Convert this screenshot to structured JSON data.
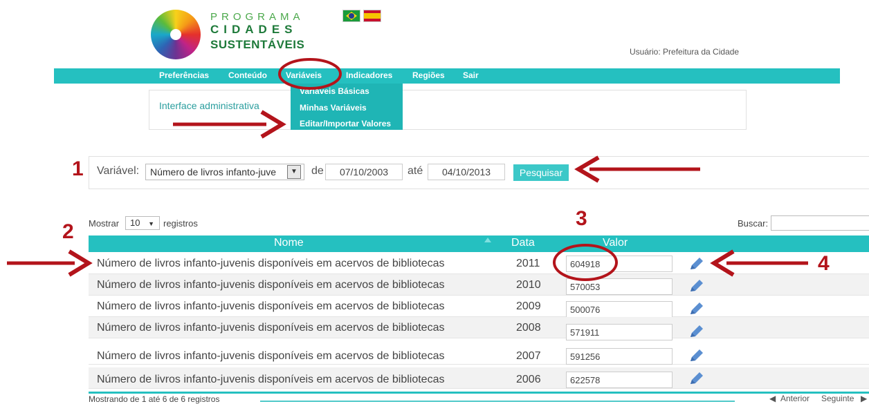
{
  "header": {
    "logo_line1": "PROGRAMA",
    "logo_line2": "CIDADES",
    "logo_line3": "SUSTENTÁVEIS",
    "user_label": "Usuário: Prefeitura da Cidade",
    "flags": [
      "brazil-flag-icon",
      "spain-flag-icon"
    ]
  },
  "nav": {
    "items": [
      "Preferências",
      "Conteúdo",
      "Variáveis",
      "Indicadores",
      "Regiões",
      "Sair"
    ],
    "dropdown": [
      "Variáveis Básicas",
      "Minhas Variáveis",
      "Editar/Importar Valores"
    ]
  },
  "admin": {
    "title": "Interface administrativa"
  },
  "filter": {
    "variable_label": "Variável:",
    "variable_value": "Número de livros infanto-juve",
    "from_label": "de",
    "from_value": "07/10/2003",
    "to_label": "até",
    "to_value": "04/10/2013",
    "search_button": "Pesquisar"
  },
  "table": {
    "show_prefix": "Mostrar",
    "show_value": "10",
    "show_suffix": "registros",
    "search_label": "Buscar:",
    "columns": [
      "Nome",
      "Data",
      "Valor"
    ],
    "rows": [
      {
        "name": "Número de livros infanto-juvenis disponíveis em acervos de bibliotecas",
        "year": "2011",
        "value": "604918"
      },
      {
        "name": "Número de livros infanto-juvenis disponíveis em acervos de bibliotecas",
        "year": "2010",
        "value": "570053"
      },
      {
        "name": "Número de livros infanto-juvenis disponíveis em acervos de bibliotecas",
        "year": "2009",
        "value": "500076"
      },
      {
        "name": "Número de livros infanto-juvenis disponíveis em acervos de bibliotecas",
        "year": "2008",
        "value": "571911"
      },
      {
        "name": "Número de livros infanto-juvenis disponíveis em acervos de bibliotecas",
        "year": "2007",
        "value": "591256"
      },
      {
        "name": "Número de livros infanto-juvenis disponíveis em acervos de bibliotecas",
        "year": "2006",
        "value": "622578"
      }
    ],
    "info": "Mostrando de 1 até 6 de 6 registros",
    "prev": "Anterior",
    "next": "Seguinte"
  },
  "annotations": {
    "n1": "1",
    "n2": "2",
    "n3": "3",
    "n4": "4",
    "color": "#b3141b"
  },
  "colors": {
    "teal": "#25c0c0",
    "green": "#1e7a3a"
  }
}
